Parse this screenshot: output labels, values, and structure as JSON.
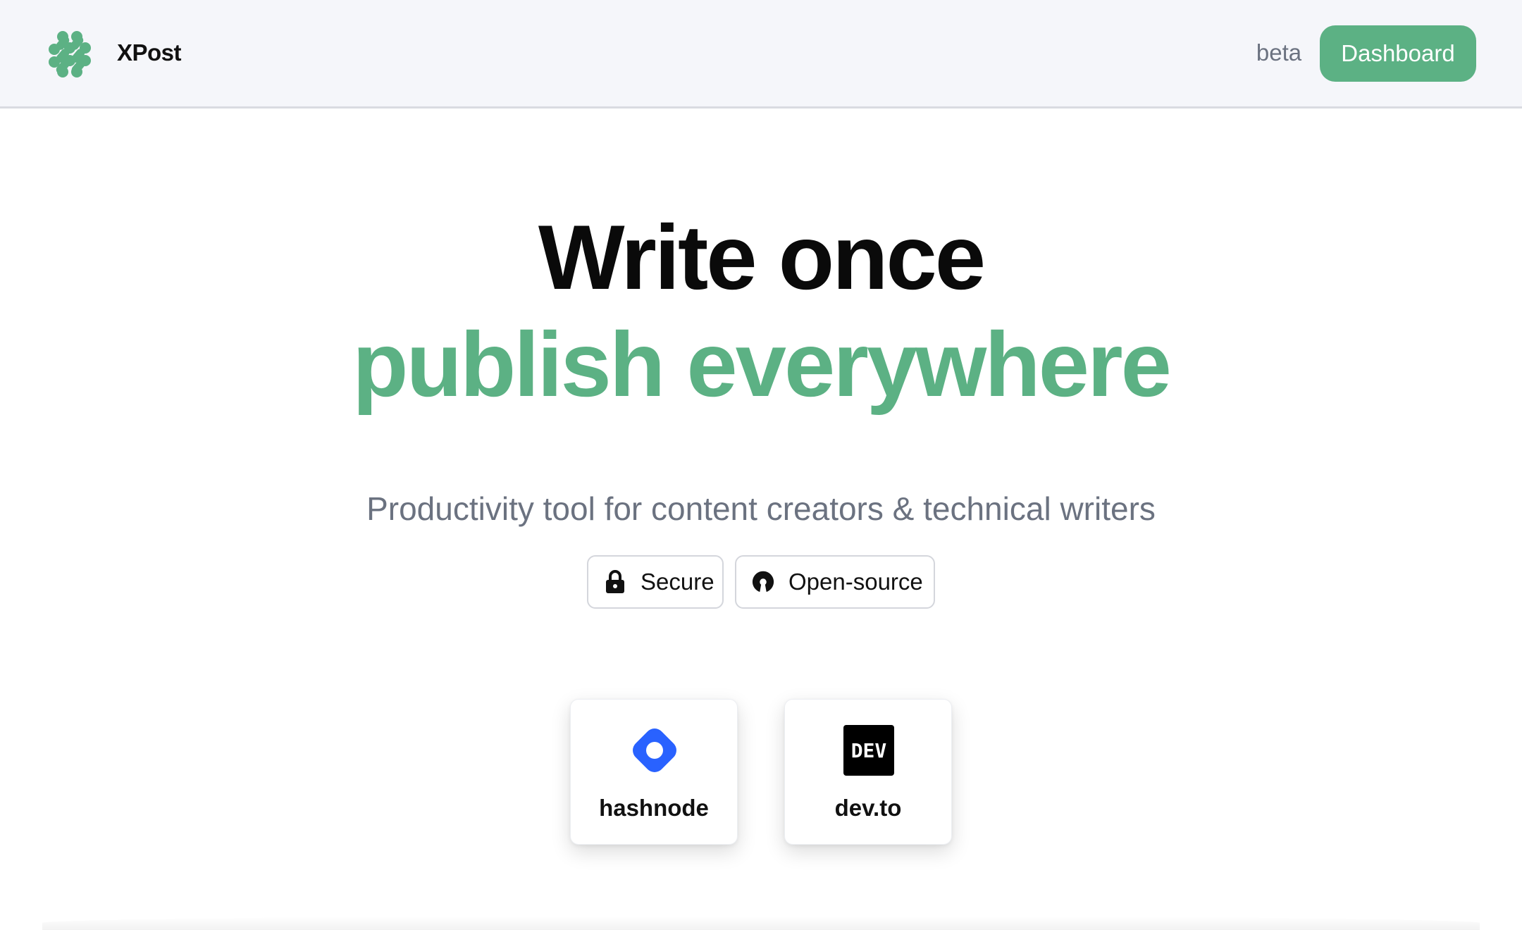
{
  "header": {
    "brand": "XPost",
    "logo_icon": "xpost-logo-icon",
    "beta_label": "beta",
    "dashboard_label": "Dashboard"
  },
  "hero": {
    "line1": "Write once",
    "line2": "publish everywhere",
    "subtitle": "Productivity tool for content creators & technical writers"
  },
  "chips": [
    {
      "label": "Secure",
      "icon": "lock-icon"
    },
    {
      "label": "Open-source",
      "icon": "open-source-icon"
    }
  ],
  "platforms": [
    {
      "label": "hashnode",
      "icon": "hashnode-logo-icon"
    },
    {
      "label": "dev.to",
      "icon": "devto-logo-icon",
      "logo_text": "DEV"
    }
  ],
  "colors": {
    "accent": "#5cb184",
    "header_bg": "#f5f6fa",
    "muted_text": "#6b7280",
    "hashnode_blue": "#2962ff"
  }
}
